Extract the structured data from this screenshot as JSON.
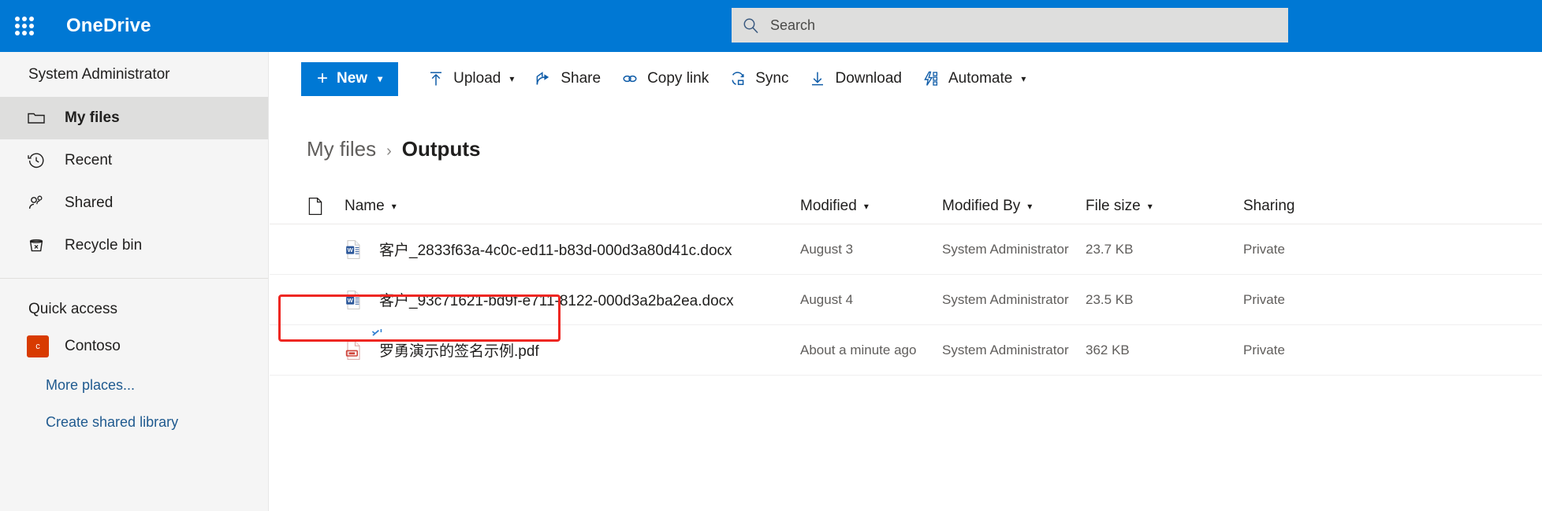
{
  "theme": {
    "brand_blue": "#0078d4",
    "highlight_red": "#ee2722",
    "site_tile": "#d83b01",
    "link_blue": "#1f5a8f"
  },
  "suite": {
    "waffle_icon": "app-launcher-waffle-icon",
    "brand": "OneDrive",
    "search": {
      "icon": "search-icon",
      "placeholder": "Search",
      "value": ""
    }
  },
  "sidebar": {
    "user": "System Administrator",
    "items": [
      {
        "label": "My files",
        "icon": "folder-icon",
        "selected": true
      },
      {
        "label": "Recent",
        "icon": "clock-history-icon",
        "selected": false
      },
      {
        "label": "Shared",
        "icon": "people-icon",
        "selected": false
      },
      {
        "label": "Recycle bin",
        "icon": "trash-icon",
        "selected": false
      }
    ],
    "quick_access": {
      "title": "Quick access",
      "sites": [
        {
          "label": "Contoso",
          "initial": "c",
          "color": "#d83b01"
        }
      ],
      "links": [
        "More places...",
        "Create shared library"
      ]
    }
  },
  "toolbar": {
    "new_label": "New",
    "new_plus": "+",
    "new_chevron": "⌄",
    "commands": [
      {
        "label": "Upload",
        "icon": "upload-arrow-icon",
        "chevron": true
      },
      {
        "label": "Share",
        "icon": "share-icon",
        "chevron": false
      },
      {
        "label": "Copy link",
        "icon": "link-chain-icon",
        "chevron": false
      },
      {
        "label": "Sync",
        "icon": "sync-icon",
        "chevron": false
      },
      {
        "label": "Download",
        "icon": "download-arrow-icon",
        "chevron": false
      },
      {
        "label": "Automate",
        "icon": "automate-flow-icon",
        "chevron": true
      }
    ]
  },
  "breadcrumb": {
    "parent": "My files",
    "separator": "›",
    "current": "Outputs"
  },
  "table": {
    "headers": {
      "icon": "document-type-icon",
      "name": "Name",
      "modified": "Modified",
      "modified_by": "Modified By",
      "file_size": "File size",
      "sharing": "Sharing"
    },
    "rows": [
      {
        "icon": "word-document-icon",
        "name": "客户_2833f63a-4c0c-ed11-b83d-000d3a80d41c.docx",
        "modified": "August 3",
        "modified_by": "System Administrator",
        "file_size": "23.7 KB",
        "sharing": "Private",
        "highlighted": false,
        "new_marker": false
      },
      {
        "icon": "word-document-icon",
        "name": "客户_93c71621-bd9f-e711-8122-000d3a2ba2ea.docx",
        "modified": "August 4",
        "modified_by": "System Administrator",
        "file_size": "23.5 KB",
        "sharing": "Private",
        "highlighted": false,
        "new_marker": false
      },
      {
        "icon": "pdf-document-icon",
        "name": "罗勇演示的签名示例.pdf",
        "modified": "About a minute ago",
        "modified_by": "System Administrator",
        "file_size": "362 KB",
        "sharing": "Private",
        "highlighted": true,
        "new_marker": true
      }
    ]
  }
}
